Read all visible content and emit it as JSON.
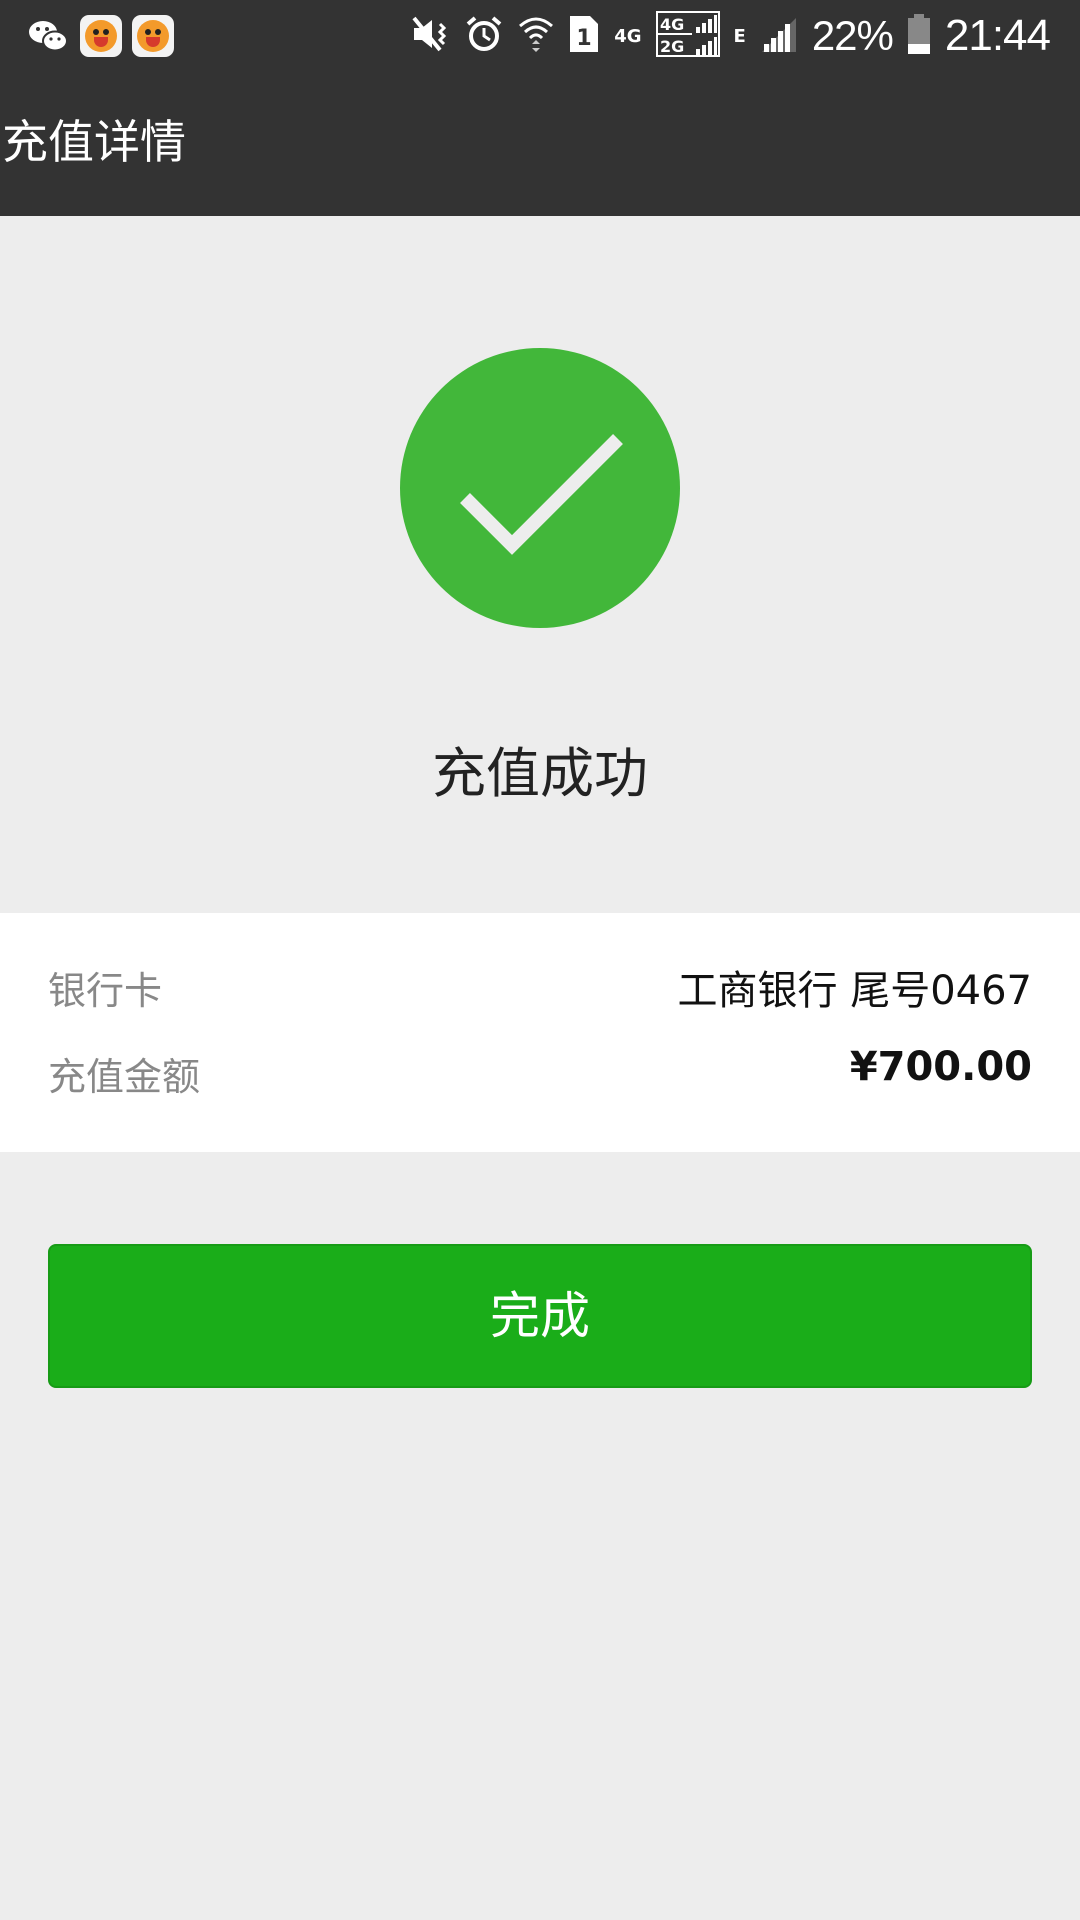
{
  "status_bar": {
    "left_icons": [
      "wechat-icon",
      "tiger-app-icon",
      "tiger-app-icon"
    ],
    "network_4g": "4G",
    "network_4g_2g": [
      "4G",
      "2G"
    ],
    "network_e": "E",
    "battery_percent": "22%",
    "time": "21:44",
    "sim_slot": "1"
  },
  "header": {
    "title": "充值详情"
  },
  "result": {
    "status_icon": "check-circle-icon",
    "status_color": "#42b73a",
    "message": "充值成功"
  },
  "details": {
    "bank_card_label": "银行卡",
    "bank_card_value": "工商银行 尾号0467",
    "amount_label": "充值金额",
    "amount_value": "¥700.00"
  },
  "actions": {
    "done_label": "完成",
    "done_color": "#1aad19"
  }
}
